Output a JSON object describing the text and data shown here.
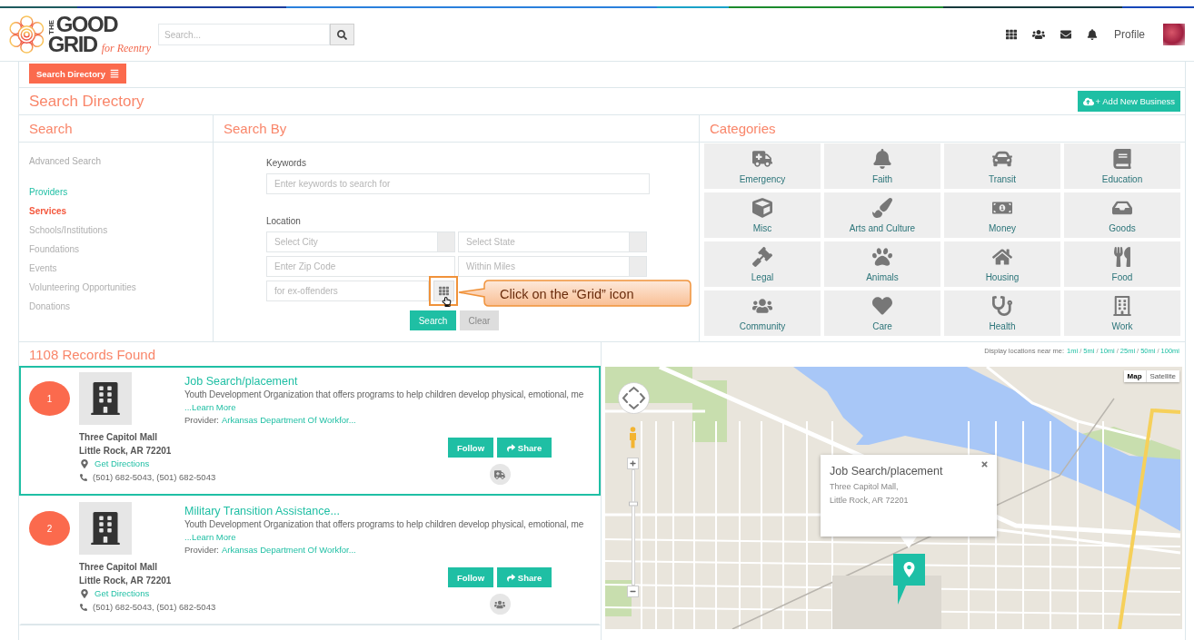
{
  "header": {
    "logo": {
      "prefix": "THE",
      "line_1": "GOOD",
      "line_2": "GRID",
      "tagline": "for Reentry"
    },
    "search": {
      "placeholder": "Search..."
    },
    "profile": "Profile"
  },
  "toolbar": {
    "menu_button": "Search Directory"
  },
  "page": {
    "title": "Search Directory",
    "add_button": "+ Add New Business"
  },
  "search_panel": {
    "title": "Search",
    "advanced": "Advanced Search",
    "items": [
      {
        "label": "Providers",
        "selected": false,
        "highlighted": true
      },
      {
        "label": "Services",
        "selected": true,
        "highlighted": false
      },
      {
        "label": "Schools/Institutions",
        "selected": false,
        "highlighted": false
      },
      {
        "label": "Foundations",
        "selected": false,
        "highlighted": false
      },
      {
        "label": "Events",
        "selected": false,
        "highlighted": false
      },
      {
        "label": "Volunteering Opportunities",
        "selected": false,
        "highlighted": false
      },
      {
        "label": "Donations",
        "selected": false,
        "highlighted": false
      }
    ]
  },
  "search_by": {
    "title": "Search By",
    "keywords": {
      "label": "Keywords",
      "placeholder": "Enter keywords to search for"
    },
    "location": {
      "label": "Location",
      "fields": [
        {
          "placeholder": "Select City",
          "kind": "select"
        },
        {
          "placeholder": "Select State",
          "kind": "select"
        },
        {
          "placeholder": "Enter Zip Code",
          "kind": "text"
        },
        {
          "placeholder": "Within Miles",
          "kind": "select"
        },
        {
          "placeholder": "for ex-offenders",
          "kind": "picker"
        }
      ]
    },
    "search_button": "Search",
    "clear_button": "Clear",
    "callout": "Click on the “Grid” icon"
  },
  "categories": {
    "title": "Categories",
    "items": [
      {
        "label": "Emergency"
      },
      {
        "label": "Faith"
      },
      {
        "label": "Transit"
      },
      {
        "label": "Education"
      },
      {
        "label": "Misc"
      },
      {
        "label": "Arts and Culture"
      },
      {
        "label": "Money"
      },
      {
        "label": "Goods"
      },
      {
        "label": "Legal"
      },
      {
        "label": "Animals"
      },
      {
        "label": "Housing"
      },
      {
        "label": "Food"
      },
      {
        "label": "Community"
      },
      {
        "label": "Care"
      },
      {
        "label": "Health"
      },
      {
        "label": "Work"
      }
    ]
  },
  "results": {
    "count": "1108 Records Found",
    "records": [
      {
        "number": "1",
        "title": "Job Search/placement",
        "description": "Youth Development Organization that offers programs to help children develop physical, emotional, me",
        "learn_more": "...Learn More",
        "provider_label": "Provider:",
        "provider": "Arkansas Department Of Workfor...",
        "address": [
          "Three Capitol Mall",
          "Little Rock, AR 72201"
        ],
        "directions": "Get Directions",
        "phone": "(501) 682-5043, (501) 682-5043",
        "follow": "Follow",
        "share": "Share",
        "selected": true
      },
      {
        "number": "2",
        "title": "Military Transition Assistance...",
        "description": "Youth Development Organization that offers programs to help children develop physical, emotional, me",
        "learn_more": "...Learn More",
        "provider_label": "Provider:",
        "provider": "Arkansas Department Of Workfor...",
        "address": [
          "Three Capitol Mall",
          "Little Rock, AR 72201"
        ],
        "directions": "Get Directions",
        "phone": "(501) 682-5043, (501) 682-5043",
        "follow": "Follow",
        "share": "Share",
        "selected": false
      }
    ]
  },
  "map": {
    "near_me": {
      "label": "Display locations near me:",
      "separator": "/",
      "options": [
        "1mi",
        "5mi",
        "10mi",
        "25mi",
        "50mi",
        "100mi"
      ]
    },
    "map_types": [
      {
        "label": "Map",
        "selected": true
      },
      {
        "label": "Satellite",
        "selected": false
      }
    ],
    "zoom": {
      "level": 0.71
    },
    "popup": {
      "title": "Job Search/placement",
      "lines": [
        "Three Capitol Mall,",
        "Little Rock, AR 72201"
      ]
    }
  }
}
